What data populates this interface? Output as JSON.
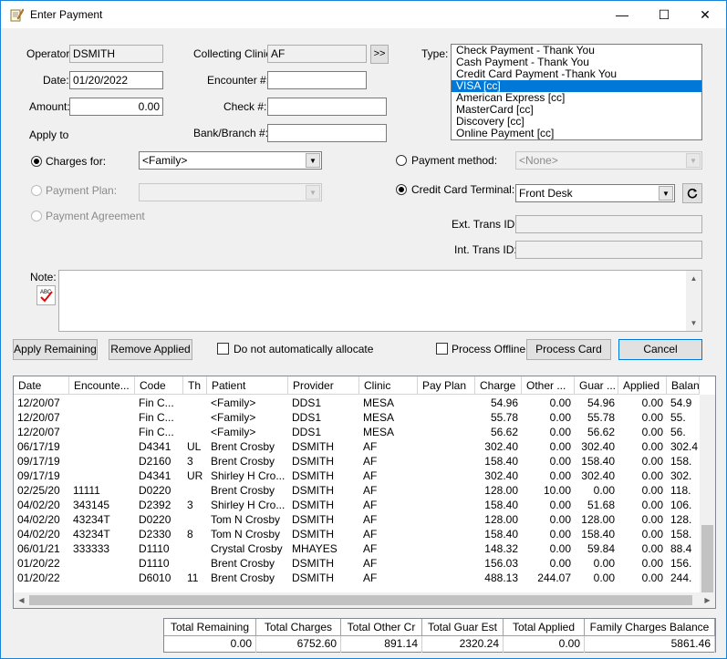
{
  "window": {
    "title": "Enter Payment",
    "minimize": "—",
    "maximize": "☐",
    "close": "✕"
  },
  "form": {
    "operator_label": "Operator:",
    "operator_value": "DSMITH",
    "date_label": "Date:",
    "date_value": "01/20/2022",
    "amount_label": "Amount:",
    "amount_value": "0.00",
    "apply_to_label": "Apply to",
    "collecting_clinic_label": "Collecting Clinic:",
    "collecting_clinic_value": "AF",
    "clinic_picker_label": ">>",
    "encounter_label": "Encounter #:",
    "encounter_value": "",
    "check_label": "Check #:",
    "check_value": "",
    "bank_label": "Bank/Branch #:",
    "bank_value": "",
    "type_label": "Type:",
    "charges_for_label": "Charges for:",
    "charges_for_value": "<Family>",
    "payment_plan_label": "Payment Plan:",
    "payment_plan_value": "",
    "payment_agreement_label": "Payment Agreement",
    "payment_method_label": "Payment method:",
    "payment_method_value": "<None>",
    "cc_terminal_label": "Credit Card Terminal:",
    "cc_terminal_value": "Front Desk",
    "ext_trans_label": "Ext. Trans ID:",
    "ext_trans_value": "",
    "int_trans_label": "Int. Trans ID:",
    "int_trans_value": "",
    "note_label": "Note:",
    "note_value": ""
  },
  "payment_types": [
    {
      "label": "Check Payment - Thank You",
      "selected": false
    },
    {
      "label": "Cash Payment - Thank You",
      "selected": false
    },
    {
      "label": "Credit Card Payment -Thank You",
      "selected": false
    },
    {
      "label": "VISA [cc]",
      "selected": true
    },
    {
      "label": "American Express [cc]",
      "selected": false
    },
    {
      "label": "MasterCard [cc]",
      "selected": false
    },
    {
      "label": "Discovery [cc]",
      "selected": false
    },
    {
      "label": "Online Payment [cc]",
      "selected": false
    }
  ],
  "buttons": {
    "apply_remaining": "Apply Remaining",
    "remove_applied": "Remove Applied",
    "no_auto_allocate": "Do not automatically allocate",
    "process_offline": "Process Offline",
    "process_card": "Process Card",
    "cancel": "Cancel"
  },
  "grid": {
    "columns": [
      "Date",
      "Encounte...",
      "Code",
      "Th",
      "Patient",
      "Provider",
      "Clinic",
      "Pay Plan",
      "Charge",
      "Other ...",
      "Guar ...",
      "Applied",
      "Balan"
    ],
    "rows": [
      [
        "12/20/07",
        "",
        "Fin C...",
        "",
        "<Family>",
        "DDS1",
        "MESA",
        "",
        "54.96",
        "0.00",
        "54.96",
        "0.00",
        "54.9"
      ],
      [
        "12/20/07",
        "",
        "Fin C...",
        "",
        "<Family>",
        "DDS1",
        "MESA",
        "",
        "55.78",
        "0.00",
        "55.78",
        "0.00",
        "55."
      ],
      [
        "12/20/07",
        "",
        "Fin C...",
        "",
        "<Family>",
        "DDS1",
        "MESA",
        "",
        "56.62",
        "0.00",
        "56.62",
        "0.00",
        "56."
      ],
      [
        "06/17/19",
        "",
        "D4341",
        "UL",
        "Brent Crosby",
        "DSMITH",
        "AF",
        "",
        "302.40",
        "0.00",
        "302.40",
        "0.00",
        "302.4"
      ],
      [
        "09/17/19",
        "",
        "D2160",
        "3",
        "Brent Crosby",
        "DSMITH",
        "AF",
        "",
        "158.40",
        "0.00",
        "158.40",
        "0.00",
        "158."
      ],
      [
        "09/17/19",
        "",
        "D4341",
        "UR",
        "Shirley H Cro...",
        "DSMITH",
        "AF",
        "",
        "302.40",
        "0.00",
        "302.40",
        "0.00",
        "302."
      ],
      [
        "02/25/20",
        "11111",
        "D0220",
        "",
        "Brent Crosby",
        "DSMITH",
        "AF",
        "",
        "128.00",
        "10.00",
        "0.00",
        "0.00",
        "118."
      ],
      [
        "04/02/20",
        "343145",
        "D2392",
        "3",
        "Shirley H Cro...",
        "DSMITH",
        "AF",
        "",
        "158.40",
        "0.00",
        "51.68",
        "0.00",
        "106."
      ],
      [
        "04/02/20",
        "43234T",
        "D0220",
        "",
        "Tom N Crosby",
        "DSMITH",
        "AF",
        "",
        "128.00",
        "0.00",
        "128.00",
        "0.00",
        "128."
      ],
      [
        "04/02/20",
        "43234T",
        "D2330",
        "8",
        "Tom N Crosby",
        "DSMITH",
        "AF",
        "",
        "158.40",
        "0.00",
        "158.40",
        "0.00",
        "158."
      ],
      [
        "06/01/21",
        "333333",
        "D1110",
        "",
        "Crystal Crosby",
        "MHAYES",
        "AF",
        "",
        "148.32",
        "0.00",
        "59.84",
        "0.00",
        "88.4"
      ],
      [
        "01/20/22",
        "",
        "D1110",
        "",
        "Brent Crosby",
        "DSMITH",
        "AF",
        "",
        "156.03",
        "0.00",
        "0.00",
        "0.00",
        "156."
      ],
      [
        "01/20/22",
        "",
        "D6010",
        "11",
        "Brent Crosby",
        "DSMITH",
        "AF",
        "",
        "488.13",
        "244.07",
        "0.00",
        "0.00",
        "244."
      ]
    ]
  },
  "totals": {
    "labels": [
      "Total Remaining",
      "Total Charges",
      "Total Other Cr",
      "Total Guar Est",
      "Total Applied",
      "Family Charges Balance"
    ],
    "values": [
      "0.00",
      "6752.60",
      "891.14",
      "2320.24",
      "0.00",
      "5861.46"
    ]
  },
  "icons": {
    "spellcheck": "spellcheck-icon",
    "refresh": "refresh-icon",
    "dropdown": "chevron-down-icon"
  }
}
